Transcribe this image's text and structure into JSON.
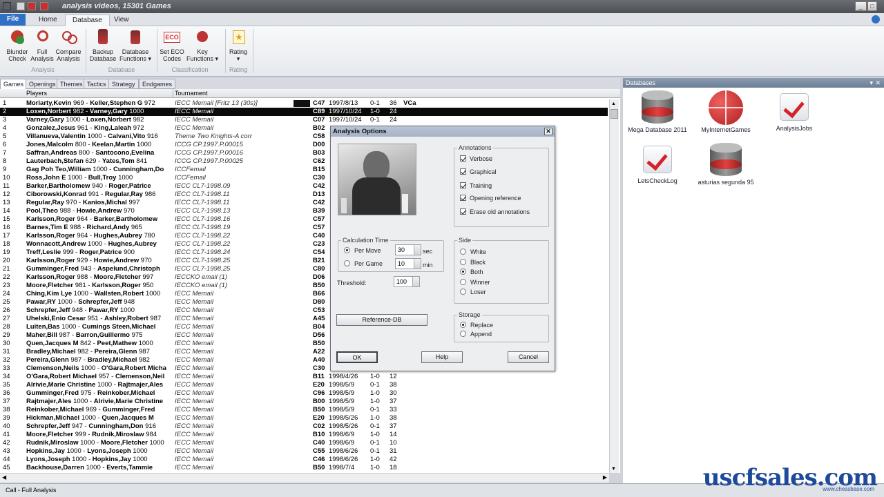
{
  "window": {
    "title": "analysis videos, 15301 Games"
  },
  "ribbon_tabs": [
    "File",
    "Home",
    "Database",
    "View"
  ],
  "ribbon": {
    "buttons": [
      {
        "label1": "Blunder",
        "label2": "Check"
      },
      {
        "label1": "Full",
        "label2": "Analysis"
      },
      {
        "label1": "Compare",
        "label2": "Analysis"
      },
      {
        "label1": "Backup",
        "label2": "Database"
      },
      {
        "label1": "Database",
        "label2": "Functions ▾"
      },
      {
        "label1": "Set ECO",
        "label2": "Codes"
      },
      {
        "label1": "Key",
        "label2": "Functions ▾"
      },
      {
        "label1": "Rating",
        "label2": "▾"
      }
    ],
    "groups": [
      "Analysis",
      "Database",
      "Classification",
      "Rating"
    ],
    "eco_icon_text": "ECO"
  },
  "game_tabs": [
    "Games",
    "Openings",
    "Themes",
    "Tactics",
    "Strategy",
    "Endgames"
  ],
  "list": {
    "headers": {
      "players": "Players",
      "tournament": "Tournament"
    },
    "rows": [
      {
        "n": "1",
        "w": "Moriarty,Kevin",
        "we": "969",
        "b": "Keller,Stephen G",
        "be": "972",
        "t": "IECC Memail [Fritz 13 (30s)]",
        "eco": "C47",
        "date": "1997/8/13",
        "res": "0-1",
        "mv": "36",
        "x": "VCa"
      },
      {
        "n": "2",
        "w": "Loxen,Norbert",
        "we": "982",
        "b": "Varney,Gary",
        "be": "1000",
        "t": "IECC Memail",
        "eco": "C89",
        "date": "1997/10/24",
        "res": "1-0",
        "mv": "24",
        "x": ""
      },
      {
        "n": "3",
        "w": "Varney,Gary",
        "we": "1000",
        "b": "Loxen,Norbert",
        "be": "982",
        "t": "IECC Memail",
        "eco": "C07",
        "date": "1997/10/24",
        "res": "0-1",
        "mv": "24",
        "x": ""
      },
      {
        "n": "4",
        "w": "Gonzalez,Jesus",
        "we": "961",
        "b": "King,Laleah",
        "be": "972",
        "t": "IECC Memail",
        "eco": "B02",
        "date": "",
        "res": "",
        "mv": "",
        "x": ""
      },
      {
        "n": "5",
        "w": "Villanueva,Valentin",
        "we": "1000",
        "b": "Calvani,Vito",
        "be": "916",
        "t": "Theme Two Knights-A corr",
        "eco": "C58",
        "date": "",
        "res": "",
        "mv": "",
        "x": ""
      },
      {
        "n": "6",
        "w": "Jones,Malcolm",
        "we": "800",
        "b": "Keelan,Martin",
        "be": "1000",
        "t": "ICCG CP.1997.P.00015",
        "eco": "D00",
        "date": "",
        "res": "",
        "mv": "",
        "x": ""
      },
      {
        "n": "7",
        "w": "Saffran,Andreas",
        "we": "800",
        "b": "Santocono,Evelina",
        "be": "",
        "t": "ICCG CP.1997.P.00016",
        "eco": "B03",
        "date": "",
        "res": "",
        "mv": "",
        "x": ""
      },
      {
        "n": "8",
        "w": "Lauterbach,Stefan",
        "we": "629",
        "b": "Yates,Tom",
        "be": "841",
        "t": "ICCG CP.1997.P.00025",
        "eco": "C62",
        "date": "",
        "res": "",
        "mv": "",
        "x": ""
      },
      {
        "n": "9",
        "w": "Gag Poh Teo,William",
        "we": "1000",
        "b": "Cunningham,Do",
        "be": "",
        "t": "ICCFemail",
        "eco": "B15",
        "date": "",
        "res": "",
        "mv": "",
        "x": ""
      },
      {
        "n": "10",
        "w": "Ross,John E",
        "we": "1000",
        "b": "Bull,Troy",
        "be": "1000",
        "t": "ICCFemail",
        "eco": "C30",
        "date": "",
        "res": "",
        "mv": "",
        "x": ""
      },
      {
        "n": "11",
        "w": "Barker,Bartholomew",
        "we": "940",
        "b": "Roger,Patrice",
        "be": "",
        "t": "IECC CL7-1998.09",
        "eco": "C42",
        "date": "",
        "res": "",
        "mv": "",
        "x": ""
      },
      {
        "n": "12",
        "w": "Ciborowski,Konrad",
        "we": "991",
        "b": "Regular,Ray",
        "be": "986",
        "t": "IECC CL7-1998.11",
        "eco": "D13",
        "date": "",
        "res": "",
        "mv": "",
        "x": ""
      },
      {
        "n": "13",
        "w": "Regular,Ray",
        "we": "970",
        "b": "Kanios,Michal",
        "be": "997",
        "t": "IECC CL7-1998.11",
        "eco": "C42",
        "date": "",
        "res": "",
        "mv": "",
        "x": ""
      },
      {
        "n": "14",
        "w": "Pool,Theo",
        "we": "988",
        "b": "Howie,Andrew",
        "be": "970",
        "t": "IECC CL7-1998.13",
        "eco": "B39",
        "date": "",
        "res": "",
        "mv": "",
        "x": ""
      },
      {
        "n": "15",
        "w": "Karlsson,Roger",
        "we": "964",
        "b": "Barker,Bartholomew",
        "be": "",
        "t": "IECC CL7-1998.16",
        "eco": "C57",
        "date": "",
        "res": "",
        "mv": "",
        "x": ""
      },
      {
        "n": "16",
        "w": "Barnes,Tim E",
        "we": "988",
        "b": "Richard,Andy",
        "be": "965",
        "t": "IECC CL7-1998.19",
        "eco": "C57",
        "date": "",
        "res": "",
        "mv": "",
        "x": ""
      },
      {
        "n": "17",
        "w": "Karlsson,Roger",
        "we": "964",
        "b": "Hughes,Aubrey",
        "be": "780",
        "t": "IECC CL7-1998.22",
        "eco": "C40",
        "date": "",
        "res": "",
        "mv": "",
        "x": ""
      },
      {
        "n": "18",
        "w": "Wonnacott,Andrew",
        "we": "1000",
        "b": "Hughes,Aubrey",
        "be": "",
        "t": "IECC CL7-1998.22",
        "eco": "C23",
        "date": "",
        "res": "",
        "mv": "",
        "x": ""
      },
      {
        "n": "19",
        "w": "Treff,Leslie",
        "we": "999",
        "b": "Roger,Patrice",
        "be": "900",
        "t": "IECC CL7-1998.24",
        "eco": "C54",
        "date": "",
        "res": "",
        "mv": "",
        "x": ""
      },
      {
        "n": "20",
        "w": "Karlsson,Roger",
        "we": "929",
        "b": "Howie,Andrew",
        "be": "970",
        "t": "IECC CL7-1998.25",
        "eco": "B21",
        "date": "",
        "res": "",
        "mv": "",
        "x": ""
      },
      {
        "n": "21",
        "w": "Gumminger,Fred",
        "we": "943",
        "b": "Aspelund,Christoph",
        "be": "",
        "t": "IECC CL7-1998.25",
        "eco": "C80",
        "date": "",
        "res": "",
        "mv": "",
        "x": ""
      },
      {
        "n": "22",
        "w": "Karlsson,Roger",
        "we": "988",
        "b": "Moore,Fletcher",
        "be": "997",
        "t": "IECCKO email (1)",
        "eco": "D06",
        "date": "",
        "res": "",
        "mv": "",
        "x": ""
      },
      {
        "n": "23",
        "w": "Moore,Fletcher",
        "we": "981",
        "b": "Karlsson,Roger",
        "be": "950",
        "t": "IECCKO email (1)",
        "eco": "B50",
        "date": "",
        "res": "",
        "mv": "",
        "x": ""
      },
      {
        "n": "24",
        "w": "Ching,Kim Lye",
        "we": "1000",
        "b": "Wallsten,Robert",
        "be": "1000",
        "t": "IECC Memail",
        "eco": "B66",
        "date": "",
        "res": "",
        "mv": "",
        "x": ""
      },
      {
        "n": "25",
        "w": "Pawar,RY",
        "we": "1000",
        "b": "Schrepfer,Jeff",
        "be": "948",
        "t": "IECC Memail",
        "eco": "D80",
        "date": "",
        "res": "",
        "mv": "",
        "x": ""
      },
      {
        "n": "26",
        "w": "Schrepfer,Jeff",
        "we": "948",
        "b": "Pawar,RY",
        "be": "1000",
        "t": "IECC Memail",
        "eco": "C53",
        "date": "",
        "res": "",
        "mv": "",
        "x": ""
      },
      {
        "n": "27",
        "w": "Uhelski,Enio Cesar",
        "we": "951",
        "b": "Ashley,Robert",
        "be": "987",
        "t": "IECC Memail",
        "eco": "A45",
        "date": "",
        "res": "",
        "mv": "",
        "x": ""
      },
      {
        "n": "28",
        "w": "Luiten,Bas",
        "we": "1000",
        "b": "Cumings Steen,Michael",
        "be": "",
        "t": "IECC Memail",
        "eco": "B04",
        "date": "",
        "res": "",
        "mv": "",
        "x": ""
      },
      {
        "n": "29",
        "w": "Maher,Bill",
        "we": "987",
        "b": "Barron,Guillermo",
        "be": "975",
        "t": "IECC Memail",
        "eco": "D56",
        "date": "",
        "res": "",
        "mv": "",
        "x": ""
      },
      {
        "n": "30",
        "w": "Quen,Jacques M",
        "we": "842",
        "b": "Peet,Mathew",
        "be": "1000",
        "t": "IECC Memail",
        "eco": "B50",
        "date": "",
        "res": "",
        "mv": "",
        "x": ""
      },
      {
        "n": "31",
        "w": "Bradley,Michael",
        "we": "982",
        "b": "Pereira,Glenn",
        "be": "987",
        "t": "IECC Memail",
        "eco": "A22",
        "date": "",
        "res": "",
        "mv": "",
        "x": ""
      },
      {
        "n": "32",
        "w": "Pereira,Glenn",
        "we": "987",
        "b": "Bradley,Michael",
        "be": "982",
        "t": "IECC Memail",
        "eco": "A40",
        "date": "",
        "res": "",
        "mv": "",
        "x": ""
      },
      {
        "n": "33",
        "w": "Clemenson,Neils",
        "we": "1000",
        "b": "O'Gara,Robert Micha",
        "be": "",
        "t": "IECC Memail",
        "eco": "C30",
        "date": "",
        "res": "",
        "mv": "",
        "x": ""
      },
      {
        "n": "34",
        "w": "O'Gara,Robert Michael",
        "we": "957",
        "b": "Clemenson,Neil",
        "be": "",
        "t": "IECC Memail",
        "eco": "B11",
        "date": "1998/4/26",
        "res": "1-0",
        "mv": "12",
        "x": ""
      },
      {
        "n": "35",
        "w": "Alrivie,Marie Christine",
        "we": "1000",
        "b": "Rajtmajer,Ales",
        "be": "",
        "t": "IECC Memail",
        "eco": "E20",
        "date": "1998/5/9",
        "res": "0-1",
        "mv": "38",
        "x": ""
      },
      {
        "n": "36",
        "w": "Gumminger,Fred",
        "we": "975",
        "b": "Reinkober,Michael",
        "be": "",
        "t": "IECC Memail",
        "eco": "C96",
        "date": "1998/5/9",
        "res": "1-0",
        "mv": "30",
        "x": ""
      },
      {
        "n": "37",
        "w": "Rajtmajer,Ales",
        "we": "1000",
        "b": "Alrivie,Marie Christine",
        "be": "",
        "t": "IECC Memail",
        "eco": "B00",
        "date": "1998/5/9",
        "res": "1-0",
        "mv": "37",
        "x": ""
      },
      {
        "n": "38",
        "w": "Reinkober,Michael",
        "we": "969",
        "b": "Gumminger,Fred",
        "be": "",
        "t": "IECC Memail",
        "eco": "B50",
        "date": "1998/5/9",
        "res": "0-1",
        "mv": "33",
        "x": ""
      },
      {
        "n": "39",
        "w": "Hickman,Michael",
        "we": "1000",
        "b": "Quen,Jacques M",
        "be": "",
        "t": "IECC Memail",
        "eco": "E20",
        "date": "1998/5/26",
        "res": "1-0",
        "mv": "38",
        "x": ""
      },
      {
        "n": "40",
        "w": "Schrepfer,Jeff",
        "we": "947",
        "b": "Cunningham,Don",
        "be": "916",
        "t": "IECC Memail",
        "eco": "C02",
        "date": "1998/5/26",
        "res": "0-1",
        "mv": "37",
        "x": ""
      },
      {
        "n": "41",
        "w": "Moore,Fletcher",
        "we": "999",
        "b": "Rudnik,Miroslaw",
        "be": "984",
        "t": "IECC Memail",
        "eco": "B10",
        "date": "1998/6/9",
        "res": "1-0",
        "mv": "14",
        "x": ""
      },
      {
        "n": "42",
        "w": "Rudnik,Miroslaw",
        "we": "1000",
        "b": "Moore,Fletcher",
        "be": "1000",
        "t": "IECC Memail",
        "eco": "C40",
        "date": "1998/6/9",
        "res": "0-1",
        "mv": "10",
        "x": ""
      },
      {
        "n": "43",
        "w": "Hopkins,Jay",
        "we": "1000",
        "b": "Lyons,Joseph",
        "be": "1000",
        "t": "IECC Memail",
        "eco": "C55",
        "date": "1998/6/26",
        "res": "0-1",
        "mv": "31",
        "x": ""
      },
      {
        "n": "44",
        "w": "Lyons,Joseph",
        "we": "1000",
        "b": "Hopkins,Jay",
        "be": "1000",
        "t": "IECC Memail",
        "eco": "C46",
        "date": "1998/6/26",
        "res": "1-0",
        "mv": "42",
        "x": ""
      },
      {
        "n": "45",
        "w": "Backhouse,Darren",
        "we": "1000",
        "b": "Everts,Tammie",
        "be": "",
        "t": "IECC Memail",
        "eco": "B50",
        "date": "1998/7/4",
        "res": "1-0",
        "mv": "18",
        "x": ""
      }
    ]
  },
  "databases": {
    "header": "Databases",
    "items": [
      {
        "label": "Mega Database 2011",
        "kind": "cylinder"
      },
      {
        "label": "MyInternetGames",
        "kind": "ball"
      },
      {
        "label": "AnalysisJobs",
        "kind": "check"
      },
      {
        "label": "LetsCheckLog",
        "kind": "check"
      },
      {
        "label": "asturias segunda 95",
        "kind": "cylinder"
      }
    ]
  },
  "dialog": {
    "title": "Analysis Options",
    "annotations": {
      "legend": "Annotations",
      "items": [
        {
          "label": "Verbose",
          "checked": true
        },
        {
          "label": "Graphical",
          "checked": true
        },
        {
          "label": "Training",
          "checked": true
        },
        {
          "label": "Opening reference",
          "checked": true
        },
        {
          "label": "Erase old annotations",
          "checked": true
        }
      ]
    },
    "calc": {
      "legend": "Calculation Time",
      "per_move": "Per Move",
      "per_move_value": "30",
      "per_move_unit": "sec",
      "per_game": "Per Game",
      "per_game_value": "10",
      "per_game_unit": "min"
    },
    "threshold_label": "Threshold:",
    "threshold_value": "100",
    "side": {
      "legend": "Side",
      "options": [
        "White",
        "Black",
        "Both",
        "Winner",
        "Loser"
      ],
      "selected": "Both"
    },
    "storage": {
      "legend": "Storage",
      "options": [
        "Replace",
        "Append"
      ],
      "selected": "Replace"
    },
    "reference_button": "Reference-DB",
    "ok": "OK",
    "help": "Help",
    "cancel": "Cancel"
  },
  "status": {
    "text": "Call - Full Analysis"
  },
  "branding": {
    "main": "uscfsales.com",
    "sub": "www.chessbase.com"
  }
}
